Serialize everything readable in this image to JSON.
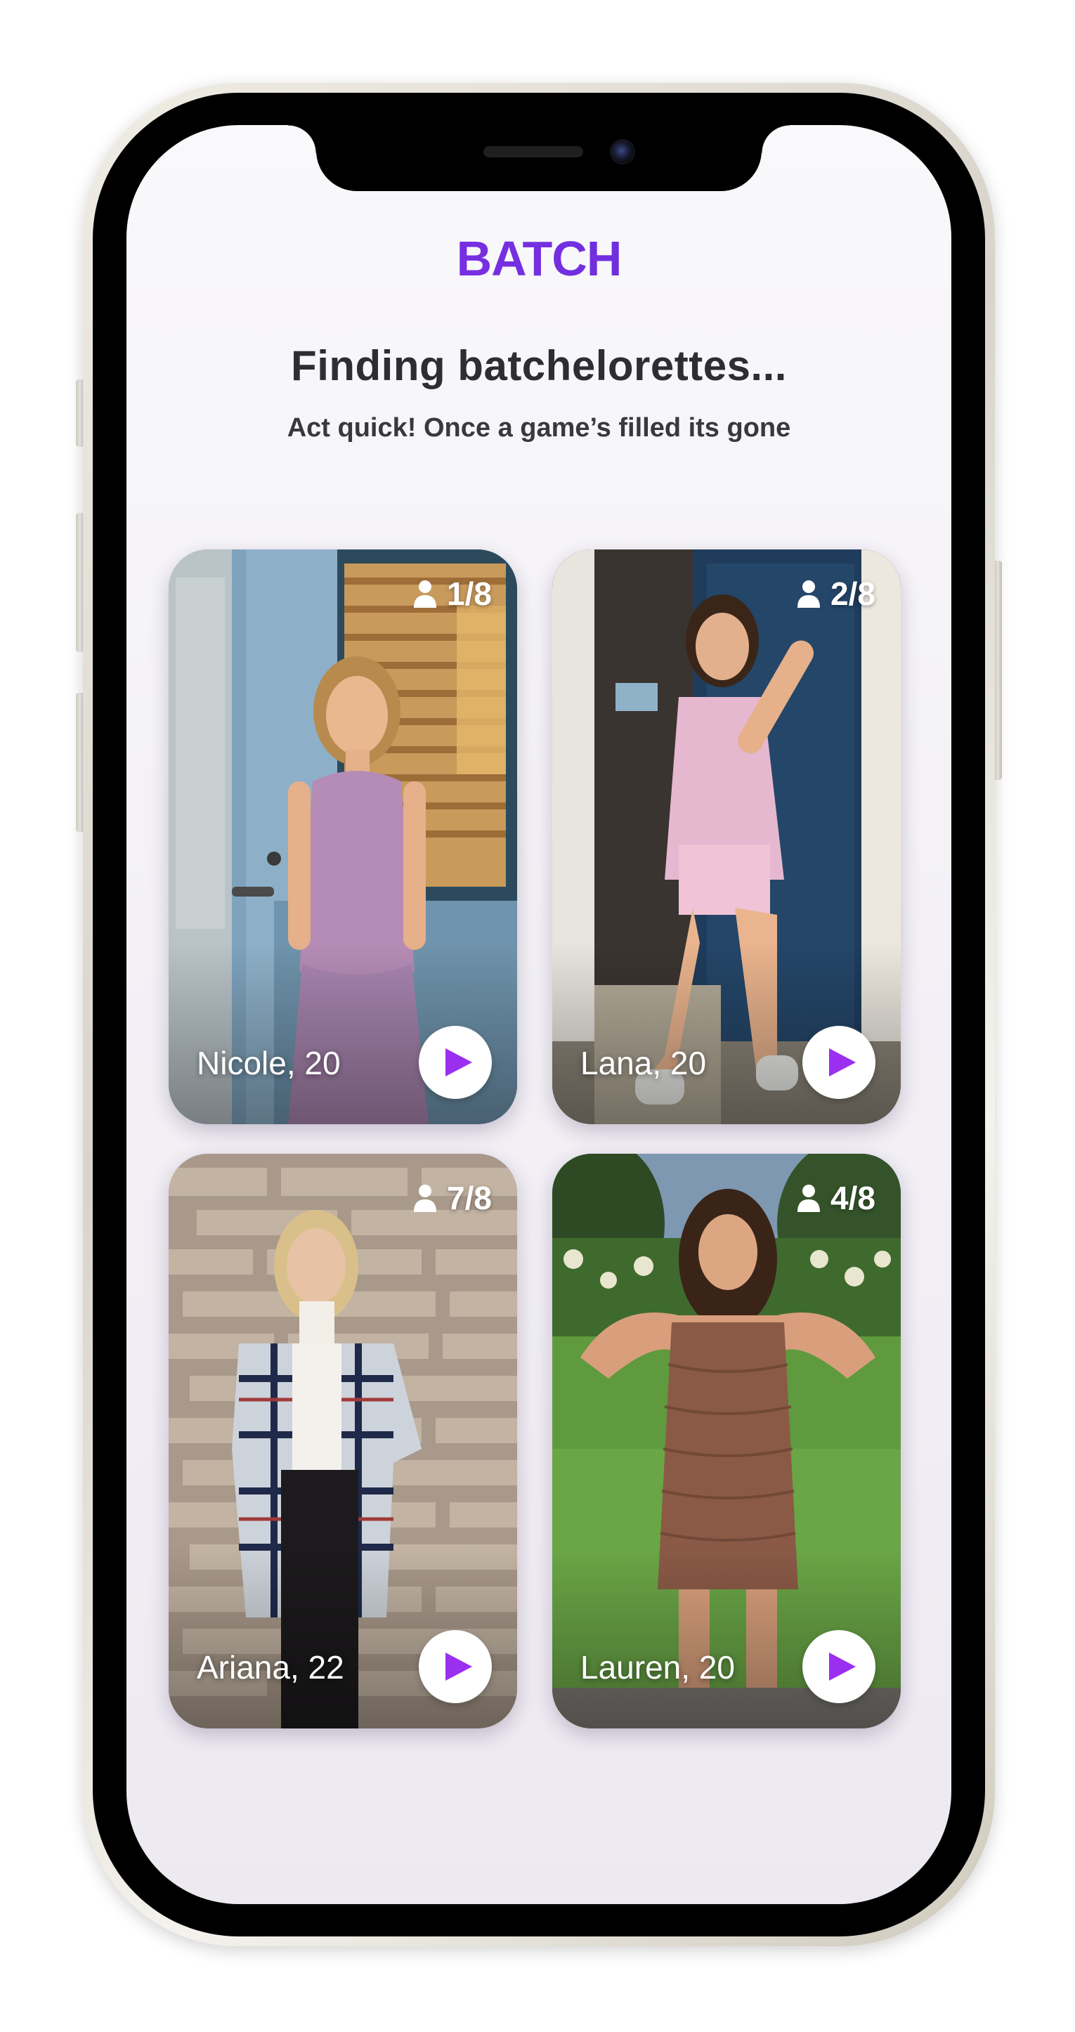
{
  "app": {
    "brand": "BATCH",
    "accent_color": "#7c2fe0"
  },
  "header": {
    "title": "Finding batchelorettes...",
    "subtitle": "Act quick! Once a game’s filled its gone"
  },
  "cards": [
    {
      "name": "Nicole, 20",
      "players": "1/8",
      "icon": "person-icon",
      "action_icon": "play-icon"
    },
    {
      "name": "Lana, 20",
      "players": "2/8",
      "icon": "person-icon",
      "action_icon": "play-icon"
    },
    {
      "name": "Ariana, 22",
      "players": "7/8",
      "icon": "person-icon",
      "action_icon": "play-icon"
    },
    {
      "name": "Lauren, 20",
      "players": "4/8",
      "icon": "person-icon",
      "action_icon": "play-icon"
    }
  ]
}
